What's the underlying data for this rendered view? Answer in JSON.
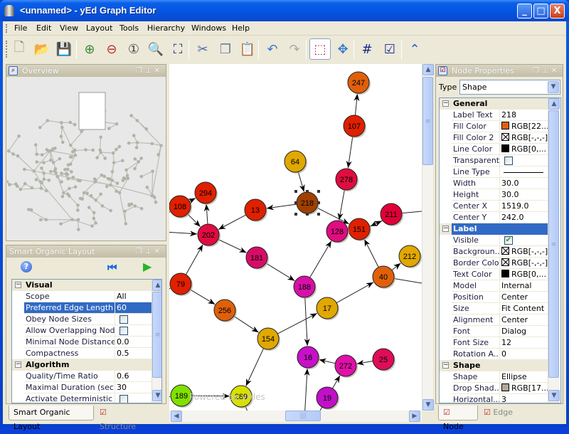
{
  "window": {
    "title": "<unnamed> - yEd Graph Editor",
    "minimize": "_",
    "maximize": "□",
    "close": "X"
  },
  "menu": [
    {
      "label": "File"
    },
    {
      "label": "Edit"
    },
    {
      "label": "View"
    },
    {
      "label": "Layout"
    },
    {
      "label": "Tools"
    },
    {
      "label": "Hierarchy"
    },
    {
      "label": "Windows"
    },
    {
      "label": "Help"
    }
  ],
  "toolbar": [
    {
      "name": "new-document",
      "glyph": "🗋"
    },
    {
      "name": "open",
      "glyph": "📂"
    },
    {
      "name": "save",
      "glyph": "💾"
    },
    {
      "name": "zoom-in",
      "glyph": "⊕"
    },
    {
      "name": "zoom-out",
      "glyph": "⊖"
    },
    {
      "name": "zoom-1-1",
      "glyph": "①"
    },
    {
      "name": "zoom",
      "glyph": "🔍"
    },
    {
      "name": "fit-content",
      "glyph": "⛶"
    },
    {
      "name": "cut",
      "glyph": "✂"
    },
    {
      "name": "copy",
      "glyph": "❐"
    },
    {
      "name": "paste",
      "glyph": "📋"
    },
    {
      "name": "undo",
      "glyph": "↶"
    },
    {
      "name": "redo",
      "glyph": "↷"
    },
    {
      "name": "edit-mode",
      "glyph": "⬚"
    },
    {
      "name": "navigate-mode",
      "glyph": "✥"
    },
    {
      "name": "grid",
      "glyph": "#"
    },
    {
      "name": "grid-snap",
      "glyph": "☑"
    },
    {
      "name": "collapse-up",
      "glyph": "⌃"
    }
  ],
  "overview": {
    "title": "Overview"
  },
  "layout_panel": {
    "title": "Smart Organic Layout",
    "sections": [
      {
        "title": "Visual",
        "rows": [
          {
            "label": "Scope",
            "value": "All"
          },
          {
            "label": "Preferred Edge Length",
            "value": "60",
            "selected": true
          },
          {
            "label": "Obey Node Sizes",
            "checkbox": false
          },
          {
            "label": "Allow Overlapping Nodes",
            "checkbox": false
          },
          {
            "label": "Minimal Node Distance",
            "value": "0.0"
          },
          {
            "label": "Compactness",
            "value": "0.5"
          }
        ]
      },
      {
        "title": "Algorithm",
        "rows": [
          {
            "label": "Quality/Time Ratio",
            "value": "0.6"
          },
          {
            "label": "Maximal Duration (sec)",
            "value": "30"
          },
          {
            "label": "Activate Deterministic M...",
            "checkbox": false
          }
        ]
      }
    ],
    "tabs": [
      {
        "label": "Smart Organic Layout",
        "active": true
      },
      {
        "label": "Structure",
        "active": false
      }
    ]
  },
  "canvas": {
    "watermark": "Powered by yFiles",
    "selected_node": "218",
    "nodes": [
      {
        "id": "247",
        "color": "#e0600a"
      },
      {
        "id": "107",
        "color": "#e02000"
      },
      {
        "id": "278",
        "color": "#e00c40"
      },
      {
        "id": "64",
        "color": "#e0a800"
      },
      {
        "id": "218",
        "color": "#a04000"
      },
      {
        "id": "13",
        "color": "#e02000"
      },
      {
        "id": "294",
        "color": "#e02000"
      },
      {
        "id": "108",
        "color": "#e02000"
      },
      {
        "id": "202",
        "color": "#e00c40"
      },
      {
        "id": "211",
        "color": "#e00038"
      },
      {
        "id": "151",
        "color": "#e02000"
      },
      {
        "id": "128",
        "color": "#e00c80"
      },
      {
        "id": "181",
        "color": "#d80c68"
      },
      {
        "id": "188",
        "color": "#d810a8"
      },
      {
        "id": "79",
        "color": "#e02000"
      },
      {
        "id": "256",
        "color": "#e0600a"
      },
      {
        "id": "17",
        "color": "#e0a800"
      },
      {
        "id": "40",
        "color": "#e0600a"
      },
      {
        "id": "212",
        "color": "#e0a800"
      },
      {
        "id": "154",
        "color": "#e0a800"
      },
      {
        "id": "16",
        "color": "#c810c8"
      },
      {
        "id": "272",
        "color": "#e010a8"
      },
      {
        "id": "25",
        "color": "#e00c58"
      },
      {
        "id": "189",
        "color": "#80e000"
      },
      {
        "id": "289",
        "color": "#d8e000"
      },
      {
        "id": "19",
        "color": "#c010c8"
      }
    ],
    "edges": [
      [
        "107",
        "247"
      ],
      [
        "107",
        "278"
      ],
      [
        "278",
        "128"
      ],
      [
        "64",
        "218"
      ],
      [
        "218",
        "13"
      ],
      [
        "218",
        "151"
      ],
      [
        "13",
        "202"
      ],
      [
        "108",
        "294"
      ],
      [
        "108",
        "202"
      ],
      [
        "202",
        "294"
      ],
      [
        "211",
        "151"
      ],
      [
        "151",
        "211"
      ],
      [
        "188",
        "128"
      ],
      [
        "40",
        "151"
      ],
      [
        "202",
        "181"
      ],
      [
        "181",
        "188"
      ],
      [
        "79",
        "202"
      ],
      [
        "79",
        "256"
      ],
      [
        "256",
        "154"
      ],
      [
        "154",
        "17"
      ],
      [
        "17",
        "40"
      ],
      [
        "40",
        "212"
      ],
      [
        "188",
        "16"
      ],
      [
        "154",
        "289"
      ],
      [
        "189",
        "289"
      ],
      [
        "272",
        "16"
      ],
      [
        "25",
        "272"
      ],
      [
        "19",
        "272"
      ]
    ]
  },
  "properties": {
    "title": "Node Properties",
    "type_label": "Type",
    "type_value": "Shape",
    "sections": [
      {
        "title": "General",
        "rows": [
          {
            "label": "Label Text",
            "value": "218"
          },
          {
            "label": "Fill Color",
            "value": "RGB[22...",
            "swatch": "#e0600a"
          },
          {
            "label": "Fill Color 2",
            "value": "RGB[-,-,-]",
            "swatch": "none"
          },
          {
            "label": "Line Color",
            "value": "RGB[0,...",
            "swatch": "#000000"
          },
          {
            "label": "Transparent",
            "checkbox": false
          },
          {
            "label": "Line Type",
            "line": true
          },
          {
            "label": "Width",
            "value": "30.0"
          },
          {
            "label": "Height",
            "value": "30.0"
          },
          {
            "label": "Center X",
            "value": "1519.0"
          },
          {
            "label": "Center Y",
            "value": "242.0"
          }
        ]
      },
      {
        "title": "Label",
        "selected": true,
        "rows": [
          {
            "label": "Visible",
            "checkbox": true
          },
          {
            "label": "Backgroun...",
            "value": "RGB[-,-,-]",
            "swatch": "none"
          },
          {
            "label": "Border Color",
            "value": "RGB[-,-,-]",
            "swatch": "none"
          },
          {
            "label": "Text Color",
            "value": "RGB[0,...",
            "swatch": "#000000"
          },
          {
            "label": "Model",
            "value": "Internal"
          },
          {
            "label": "Position",
            "value": "Center"
          },
          {
            "label": "Size",
            "value": "Fit Content"
          },
          {
            "label": "Alignment",
            "value": "Center"
          },
          {
            "label": "Font",
            "value": "Dialog"
          },
          {
            "label": "Font Size",
            "value": "12"
          },
          {
            "label": "Rotation A...",
            "value": "0"
          }
        ]
      },
      {
        "title": "Shape",
        "rows": [
          {
            "label": "Shape",
            "value": "Ellipse"
          },
          {
            "label": "Drop Shad...",
            "value": "RGB[17...",
            "swatch": "#b0a898"
          },
          {
            "label": "Horizontal...",
            "value": "3"
          }
        ]
      }
    ],
    "tabs": [
      {
        "label": "Node",
        "active": true
      },
      {
        "label": "Edge",
        "active": false
      }
    ]
  }
}
